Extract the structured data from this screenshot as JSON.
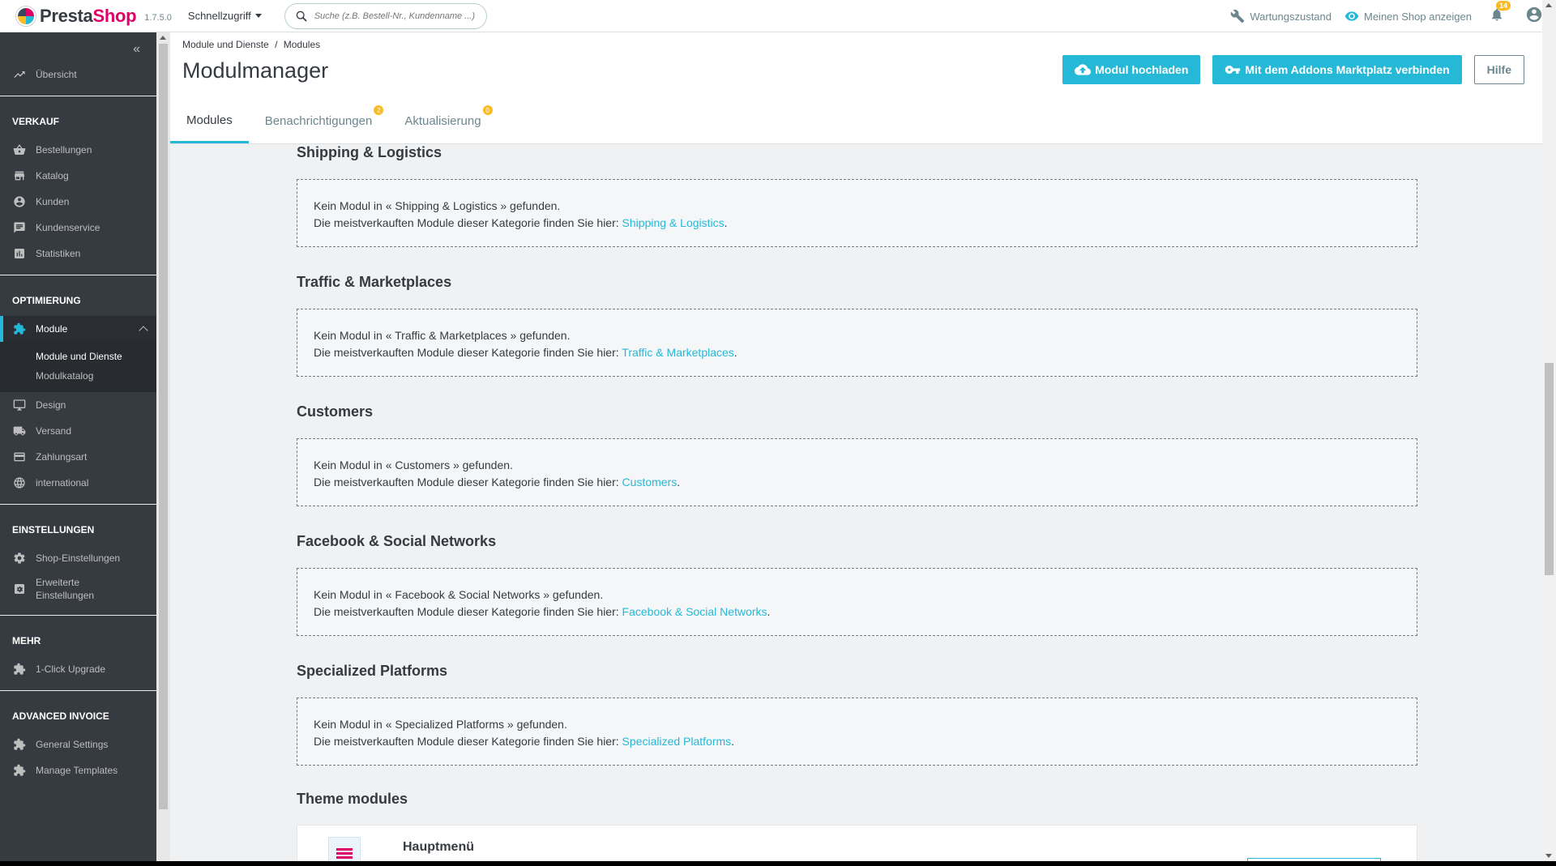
{
  "header": {
    "logo_presta": "Presta",
    "logo_shop": "Shop",
    "version": "1.7.5.0",
    "quick_access": "Schnellzugriff",
    "search_placeholder": "Suche (z.B. Bestell-Nr., Kundenname ...)",
    "maintenance": "Wartungszustand",
    "view_shop": "Meinen Shop anzeigen",
    "notifications_count": "14"
  },
  "sidebar": {
    "dashboard": "Übersicht",
    "sections": {
      "sell": "VERKAUF",
      "improve": "OPTIMIERUNG",
      "configure": "EINSTELLUNGEN",
      "more": "MEHR",
      "advanced_invoice": "ADVANCED INVOICE"
    },
    "sell_items": [
      "Bestellungen",
      "Katalog",
      "Kunden",
      "Kundenservice",
      "Statistiken"
    ],
    "modules": "Module",
    "modules_sub": [
      "Module und Dienste",
      "Modulkatalog"
    ],
    "improve_items": [
      "Design",
      "Versand",
      "Zahlungsart",
      "international"
    ],
    "configure_items": [
      "Shop-Einstellungen",
      "Erweiterte",
      "Einstellungen"
    ],
    "more_items": [
      "1-Click Upgrade"
    ],
    "invoice_items": [
      "General Settings",
      "Manage Templates"
    ]
  },
  "page": {
    "breadcrumb_parent": "Module und Dienste",
    "breadcrumb_sep": "/",
    "breadcrumb_current": "Modules",
    "title": "Modulmanager",
    "btn_upload": "Modul hochladen",
    "btn_connect": "Mit dem Addons Marktplatz verbinden",
    "btn_help": "Hilfe",
    "tabs": [
      "Modules",
      "Benachrichtigungen",
      "Aktualisierung"
    ],
    "tab_badges": [
      "2",
      "0"
    ]
  },
  "categories": [
    {
      "title": "Shipping & Logistics",
      "line1": "Kein Modul in « Shipping & Logistics » gefunden.",
      "line2": "Die meistverkauften Module dieser Kategorie finden Sie hier: ",
      "link": "Shipping & Logistics"
    },
    {
      "title": "Traffic & Marketplaces",
      "line1": "Kein Modul in « Traffic & Marketplaces » gefunden.",
      "line2": "Die meistverkauften Module dieser Kategorie finden Sie hier: ",
      "link": "Traffic & Marketplaces"
    },
    {
      "title": "Customers",
      "line1": "Kein Modul in « Customers » gefunden.",
      "line2": "Die meistverkauften Module dieser Kategorie finden Sie hier: ",
      "link": "Customers"
    },
    {
      "title": "Facebook & Social Networks",
      "line1": "Kein Modul in « Facebook & Social Networks » gefunden.",
      "line2": "Die meistverkauften Module dieser Kategorie finden Sie hier: ",
      "link": "Facebook & Social Networks"
    },
    {
      "title": "Specialized Platforms",
      "line1": "Kein Modul in « Specialized Platforms » gefunden.",
      "line2": "Die meistverkauften Module dieser Kategorie finden Sie hier: ",
      "link": "Specialized Platforms"
    }
  ],
  "theme": {
    "section_title": "Theme modules",
    "module_name": "Hauptmenü"
  },
  "colors": {
    "primary": "#25b9d7",
    "sidebar_bg": "#363a41",
    "brand_pink": "#df0067",
    "badge": "#fbbb22"
  }
}
